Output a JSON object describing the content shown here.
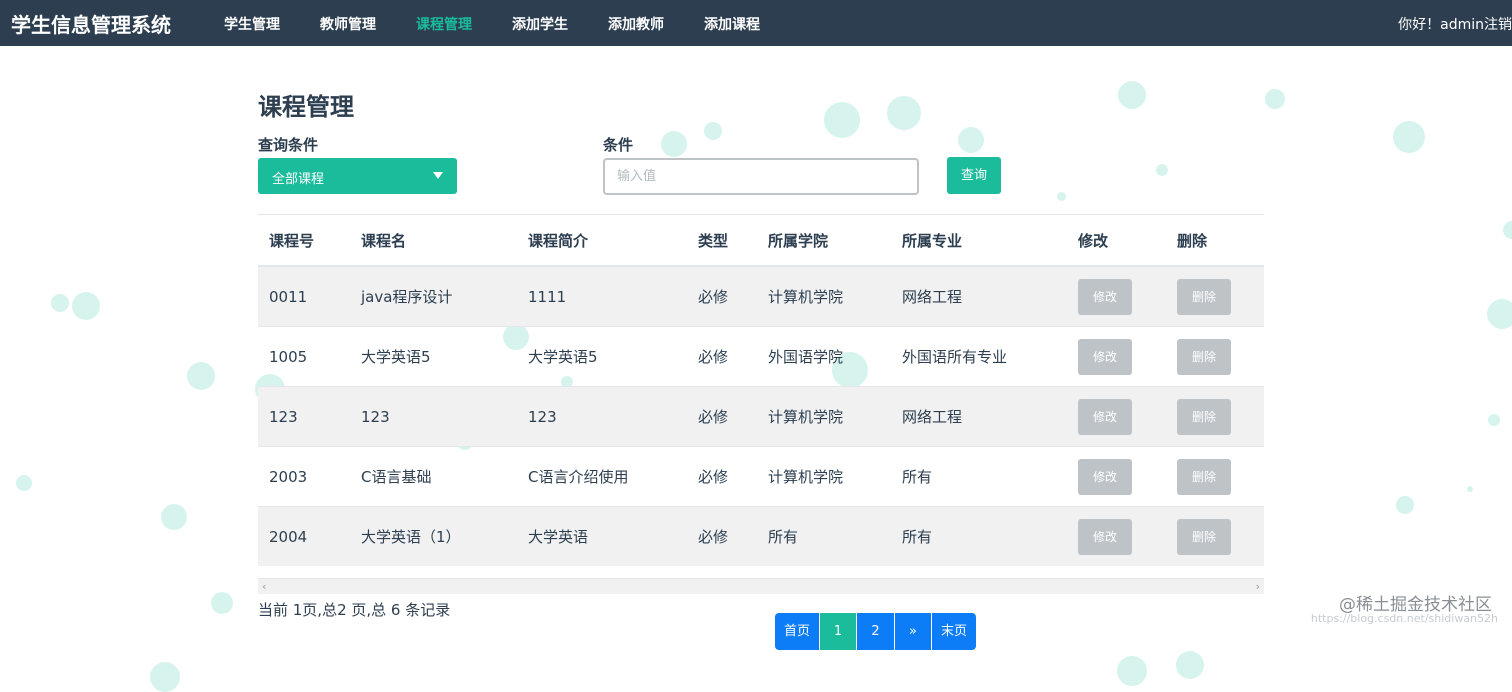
{
  "navbar": {
    "brand": "学生信息管理系统",
    "items": [
      "学生管理",
      "教师管理",
      "课程管理",
      "添加学生",
      "添加教师",
      "添加课程"
    ],
    "active_item": "课程管理",
    "greeting": "你好！admin",
    "logout": "注销"
  },
  "page": {
    "title": "课程管理",
    "query_label": "查询条件",
    "condition_label": "条件",
    "select_value": "全部课程",
    "input_placeholder": "输入值",
    "query_button": "查询"
  },
  "table": {
    "headers": [
      "课程号",
      "课程名",
      "课程简介",
      "类型",
      "所属学院",
      "所属专业",
      "修改",
      "删除"
    ],
    "rows": [
      [
        "0011",
        "java程序设计",
        "1111",
        "必修",
        "计算机学院",
        "网络工程"
      ],
      [
        "1005",
        "大学英语5",
        "大学英语5",
        "必修",
        "外国语学院",
        "外国语所有专业"
      ],
      [
        "123",
        "123",
        "123",
        "必修",
        "计算机学院",
        "网络工程"
      ],
      [
        "2003",
        "C语言基础",
        "C语言介绍使用",
        "必修",
        "计算机学院",
        "所有"
      ],
      [
        "2004",
        "大学英语（1）",
        "大学英语",
        "必修",
        "所有",
        "所有"
      ]
    ],
    "edit_label": "修改",
    "delete_label": "删除"
  },
  "footer": {
    "record_info": "当前 1页,总2 页,总 6 条记录",
    "pager": [
      "首页",
      "1",
      "2",
      "»",
      "末页"
    ],
    "current_page": "1"
  },
  "watermark": {
    "main": "@稀土掘金技术社区",
    "sub": "https://blog.csdn.net/shidiwan52h"
  },
  "colors": {
    "navbar": "#2c3e50",
    "accent": "#1abc9c",
    "pager_blue": "#0d7cf7",
    "button_gray": "#bdc3c7"
  }
}
